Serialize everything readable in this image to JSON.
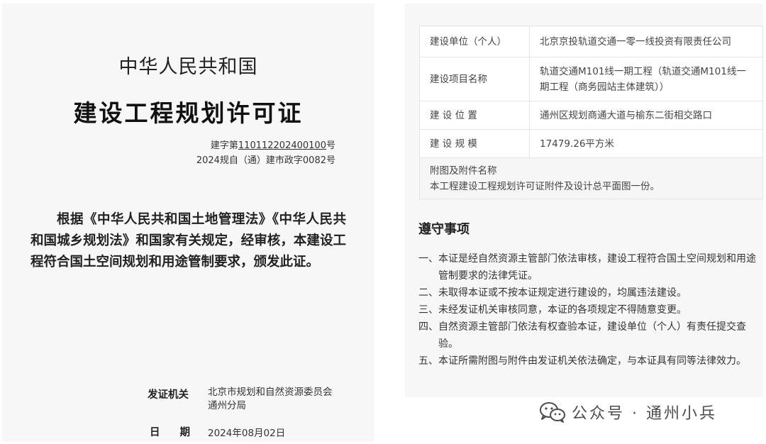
{
  "certificate": {
    "country": "中华人民共和国",
    "title": "建设工程规划许可证",
    "number_prefix": "建字第",
    "number": "110112202400100",
    "number_suffix": "号",
    "ref_no": "2024规自（通）建市政字0082号",
    "body": "根据《中华人民共和国土地管理法》《中华人民共和国城乡规划法》和国家有关规定，经审核，本建设工程符合国土空间规划和用途管制要求，颁发此证。",
    "issuer_label": "发证机关",
    "issuer_line1": "北京市规划和自然资源委员会",
    "issuer_line2": "通州分局",
    "date_label": "日期",
    "date_value": "2024年08月02日"
  },
  "info_table": {
    "rows": [
      {
        "label": "建设单位（个人）",
        "value": "北京京投轨道交通一零一线投资有限责任公司"
      },
      {
        "label": "建设项目名称",
        "value": "轨道交通M101线一期工程（轨道交通M101线一期工程（商务园站主体建筑））"
      },
      {
        "label": "建 设 位 置",
        "value": "通州区规划商通大道与榆东二街相交路口"
      },
      {
        "label": "建 设 规 模",
        "value": "17479.26平方米"
      }
    ],
    "attachment_label": "附图及附件名称",
    "attachment_value": "本工程建设工程规划许可证附件及设计总平面图一份。"
  },
  "observances": {
    "title": "遵守事项",
    "items": [
      {
        "num": "一、",
        "text": "本证是经自然资源主管部门依法审核，建设工程符合国土空间规划和用途管制要求的法律凭证。"
      },
      {
        "num": "二、",
        "text": "未取得本证或不按本证规定进行建设的，均属违法建设。"
      },
      {
        "num": "三、",
        "text": "未经发证机关审核同意，本证的各项规定不得随意变更。"
      },
      {
        "num": "四、",
        "text": "自然资源主管部门依法有权查验本证，建设单位（个人）有责任提交查验。"
      },
      {
        "num": "五、",
        "text": "本证所需附图与附件由发证机关依法确定，与本证具有同等法律效力。"
      }
    ]
  },
  "watermark": {
    "icon": "wechat-icon",
    "text": "公众号 · 通州小兵"
  }
}
